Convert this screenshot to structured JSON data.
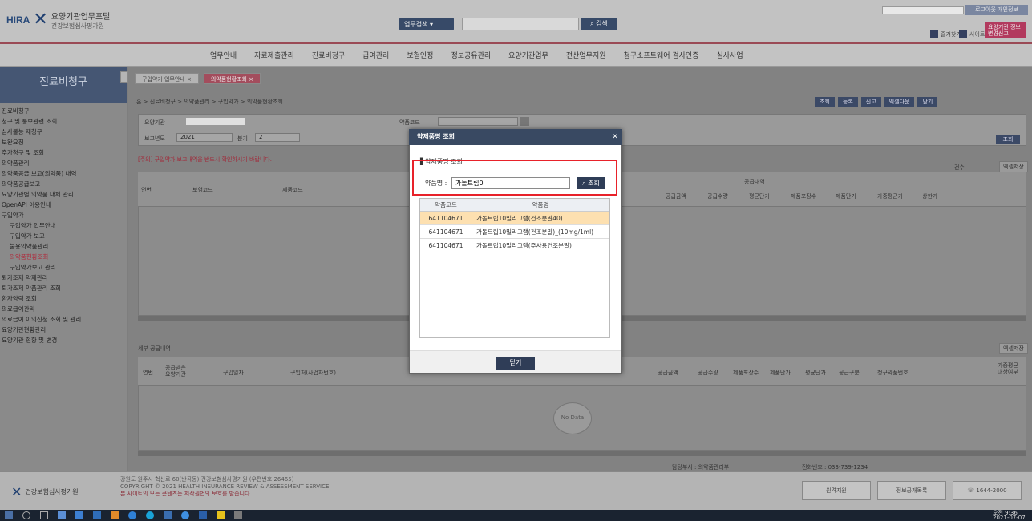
{
  "header": {
    "logo_brand": "HIRA",
    "logo_title": "요양기관업무포털",
    "logo_subtitle": "건강보험심사평가원",
    "search_select": "업무검색",
    "search_button": "검색",
    "top_link": "로그아웃 개인정보",
    "toolbar": [
      "즐겨찾기",
      "사이트맵"
    ],
    "badge": "요양기관 정보변경신고"
  },
  "nav": {
    "items": [
      "업무안내",
      "자료제출관리",
      "진료비청구",
      "급여관리",
      "보험인정",
      "정보공유관리",
      "요양기관업무",
      "전산업무지원",
      "청구소프트웨어 검사인증",
      "심사사업"
    ]
  },
  "sidebar": {
    "title": "진료비청구",
    "items": [
      {
        "label": "진료비청구"
      },
      {
        "label": "청구 및 통보관련 조회"
      },
      {
        "label": "심사불능 재청구"
      },
      {
        "label": "보완요청"
      },
      {
        "label": "추가청구 및 조회"
      },
      {
        "label": "의약품관리"
      },
      {
        "label": "의약품공급 보고(의약품) 내역"
      },
      {
        "label": "의약품공급보고"
      },
      {
        "label": "요양기관별 의약품 대체 관리"
      },
      {
        "label": "OpenAPI 이용안내"
      },
      {
        "label": "구입약가"
      },
      {
        "label": "구입약가 업무안내",
        "sub": true
      },
      {
        "label": "구입약가 보고",
        "sub": true
      },
      {
        "label": "불용의약품관리",
        "sub": true
      },
      {
        "label": "의약품현황조회",
        "sub": true,
        "active": true
      },
      {
        "label": "구입약가보고 관리",
        "sub": true
      },
      {
        "label": "퇴가조제 약제관리"
      },
      {
        "label": "퇴가조제 약품관리 조회"
      },
      {
        "label": "환자약력 조회"
      },
      {
        "label": "의료급여관리"
      },
      {
        "label": "의료급여 이의신청 조회 및 관리"
      },
      {
        "label": "요양기관현황관리"
      },
      {
        "label": "요양기관 현황 및 변경"
      }
    ]
  },
  "tabs": [
    {
      "label": "구입약가 업무안내"
    },
    {
      "label": "의약품현황조회"
    }
  ],
  "breadcrumb": "홈 > 진료비청구 > 의약품관리 > 구입약가 > 의약품현황조회",
  "action_buttons": [
    "조회",
    "등록",
    "신고",
    "엑셀다운",
    "닫기"
  ],
  "filters": {
    "row1_label": "요양기관",
    "row1b_label": "약품코드",
    "row2_label": "보고년도",
    "row2_value": "2021",
    "row2b_label": "분기",
    "row2b_value": "2",
    "search": "조회"
  },
  "notice": "[주의] 구입약가 보고내역을 반드시 확인하시기 바랍니다.",
  "grid1": {
    "headers": [
      "연번",
      "보험코드",
      "제품코드",
      "공급금액",
      "공급수량",
      "평균단가",
      "제품포장수",
      "제품단가",
      "가중평균가",
      "상한가"
    ],
    "group_header": "공급내역",
    "total_label": "건수",
    "export": "엑셀저장"
  },
  "grid2": {
    "section_title": "세부 공급내역",
    "headers": [
      "연번",
      "공급받은 요양기관",
      "구입일자",
      "구입처(사업자번호)",
      "공급금액",
      "공급수량",
      "제품포장수",
      "제품단가",
      "평균단가",
      "공급구분",
      "청구약품번호",
      "가중평균 대상여부"
    ],
    "empty": "No Data",
    "export": "엑셀저장"
  },
  "contact": {
    "dept": "담당부서 : 의약품관리부",
    "phone": "전화번호 : 033-739-1234"
  },
  "footer": {
    "brand": "건강보험심사평가원",
    "address": "강원도 원주시 혁신로 60(반곡동) 건강보험심사평가원 (우편번호 26465)",
    "copyright": "COPYRIGHT © 2021 HEALTH INSURANCE REVIEW & ASSESSMENT SERVICE",
    "notice": "본 사이트의 모든 콘텐츠는 저작권법의 보호를 받습니다.",
    "buttons": [
      "원격지원",
      "정보공개목록"
    ],
    "callcenter": "1644-2000"
  },
  "modal": {
    "title": "약제품명 조회",
    "subtitle": "약제품명 조회",
    "name_label": "약품명 :",
    "name_value": "가돌트립0",
    "search_button": "조회",
    "columns": [
      "약품코드",
      "약품명"
    ],
    "rows": [
      {
        "code": "641104671",
        "name": "가돌트립10밀리그램(건조분말40)"
      },
      {
        "code": "641104671",
        "name": "가돌트립10밀리그램(건조분말)_(10mg/1ml)"
      },
      {
        "code": "641104671",
        "name": "가돌트립10밀리그램(주사용건조분말)"
      }
    ],
    "close_button": "닫기"
  },
  "taskbar": {
    "time": "오전 9:36",
    "date": "2021-07-07"
  }
}
